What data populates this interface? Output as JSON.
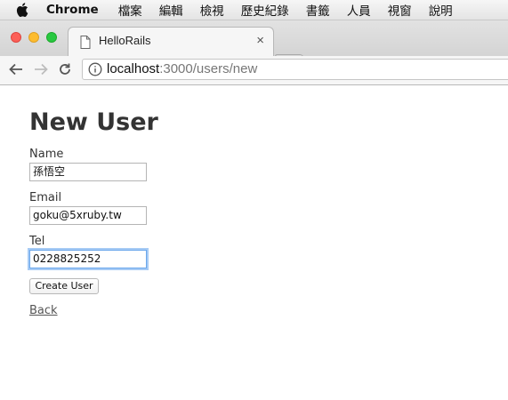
{
  "menubar": {
    "app": "Chrome",
    "items": [
      "檔案",
      "編輯",
      "檢視",
      "歷史紀錄",
      "書籤",
      "人員",
      "視窗",
      "說明"
    ]
  },
  "tab": {
    "title": "HelloRails",
    "close_glyph": "×"
  },
  "address_bar": {
    "host": "localhost",
    "path": ":3000/users/new"
  },
  "page": {
    "title": "New User",
    "form": {
      "name_label": "Name",
      "name_value": "孫悟空",
      "email_label": "Email",
      "email_value": "goku@5xruby.tw",
      "tel_label": "Tel",
      "tel_value": "0228825252",
      "submit_label": "Create User"
    },
    "back_link": "Back"
  },
  "colors": {
    "traffic_close": "#fc5f57",
    "traffic_minimize": "#fdbc2e",
    "traffic_maximize": "#28c840",
    "focus_ring": "#6aa7ec"
  },
  "icons": [
    "apple-icon",
    "document-icon",
    "close-icon",
    "back-arrow-icon",
    "forward-arrow-icon",
    "reload-icon",
    "info-icon"
  ]
}
